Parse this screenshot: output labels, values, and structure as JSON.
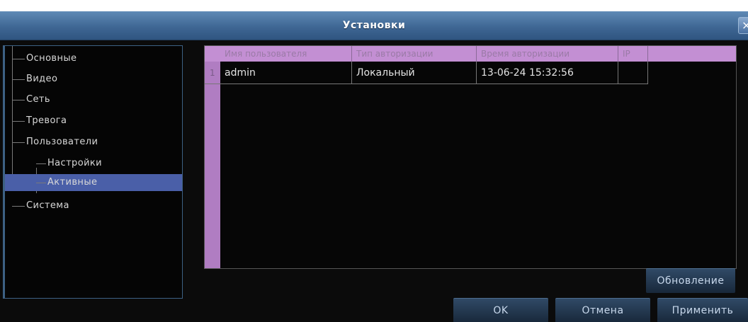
{
  "window": {
    "title": "Установки",
    "close_symbol": "×"
  },
  "sidebar": {
    "items": [
      {
        "label": "Основные"
      },
      {
        "label": "Видео"
      },
      {
        "label": "Сеть"
      },
      {
        "label": "Тревога"
      },
      {
        "label": "Пользователи"
      },
      {
        "label": "Настройки"
      },
      {
        "label": "Активные",
        "selected": true
      },
      {
        "label": "Система"
      }
    ]
  },
  "table": {
    "columns": [
      "Имя пользователя",
      "Тип авторизации",
      "Время авторизации",
      "IP"
    ],
    "rows": [
      {
        "index": "1",
        "user": "admin",
        "auth_type": "Локальный",
        "auth_time": "13-06-24 15:32:56",
        "ip": ""
      }
    ]
  },
  "buttons": {
    "refresh": "Обновление",
    "ok": "OK",
    "cancel": "Отмена",
    "apply": "Применить"
  },
  "colors": {
    "titlebar": "#3f6794",
    "selected": "#4a5fa8",
    "table_header": "#c38fd3"
  }
}
